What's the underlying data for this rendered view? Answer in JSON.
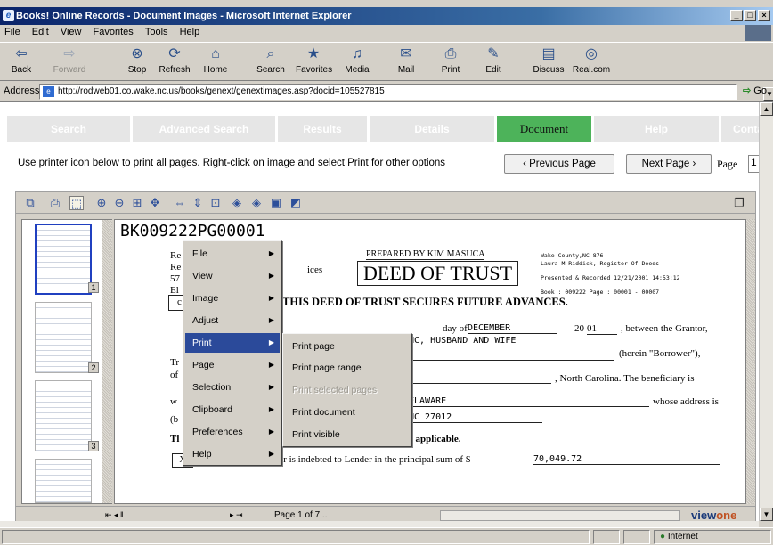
{
  "window": {
    "title": "Books! Online Records - Document Images - Microsoft Internet Explorer"
  },
  "menubar": [
    "File",
    "Edit",
    "View",
    "Favorites",
    "Tools",
    "Help"
  ],
  "toolbar": {
    "back": "Back",
    "forward": "Forward",
    "stop": "Stop",
    "refresh": "Refresh",
    "home": "Home",
    "search": "Search",
    "favorites": "Favorites",
    "media": "Media",
    "mail": "Mail",
    "print": "Print",
    "edit": "Edit",
    "discuss": "Discuss",
    "realcom": "Real.com"
  },
  "address": {
    "label": "Address",
    "url": "http://rodweb01.co.wake.nc.us/books/genext/genextimages.asp?docid=105527815",
    "go": "Go"
  },
  "navtabs": [
    "Search",
    "Advanced Search",
    "Results",
    "Details",
    "Document",
    "Help",
    "Conta"
  ],
  "instructions": "Use printer icon below to print all pages. Right-click on image and select Print for other options",
  "paging": {
    "previous": "‹ Previous Page",
    "next": "Next Page ›",
    "page_label": "Page",
    "page_value": "1"
  },
  "thumbnails": [
    "1",
    "2",
    "3"
  ],
  "document": {
    "book_page": "BK009222PG00001",
    "prepared_by": "PREPARED BY KIM MASUCA",
    "title": "DEED OF TRUST",
    "county_line1": "Wake County,NC  876",
    "county_line2": "Laura M Riddick, Register Of Deeds",
    "county_line3": "Presented & Recorded 12/21/2001 14:53:12",
    "county_line4": "Book : 009222  Page : 00001 - 00007",
    "left_frag": [
      "Re",
      "Re",
      "57",
      "El",
      "c"
    ],
    "ices": "ices",
    "secures": "THIS DEED OF TRUST SECURES FUTURE ADVANCES.",
    "day_of": "day of",
    "month": "DECEMBER",
    "year_pre": "20",
    "year_val": "01",
    "between": ", between the Grantor,",
    "husband": "NC, HUSBAND AND WIFE",
    "herein": "(herein \"Borrower\"),",
    "tr": "Tr",
    "of": "of",
    "nc_beneficiary": ", North Carolina.  The beneficiary is",
    "delaware": "ELAWARE",
    "whose": "whose address is",
    "w": "w",
    "zip": "NC  27012",
    "b": "(b",
    "th": "Tl",
    "checked": "ph preceded by a checked box is applicable.",
    "checkbox_mark": "X",
    "whereas": "WHEREAS, Borrower is indebted to Lender in the principal sum of $",
    "principal": "70,049.72"
  },
  "context_menu": [
    "File",
    "View",
    "Image",
    "Adjust",
    "Print",
    "Page",
    "Selection",
    "Clipboard",
    "Preferences",
    "Help"
  ],
  "print_submenu": [
    "Print page",
    "Print page range",
    "Print selected pages",
    "Print document",
    "Print visible"
  ],
  "viewer_status": {
    "page_of": "Page 1 of 7...",
    "logo_a": "view",
    "logo_b": "one"
  },
  "statusbar": {
    "zone": "Internet"
  },
  "colors": {
    "title_bar": "#0a246a",
    "active_tab": "#4db35a",
    "menu_highlight": "#2b4a9a"
  }
}
